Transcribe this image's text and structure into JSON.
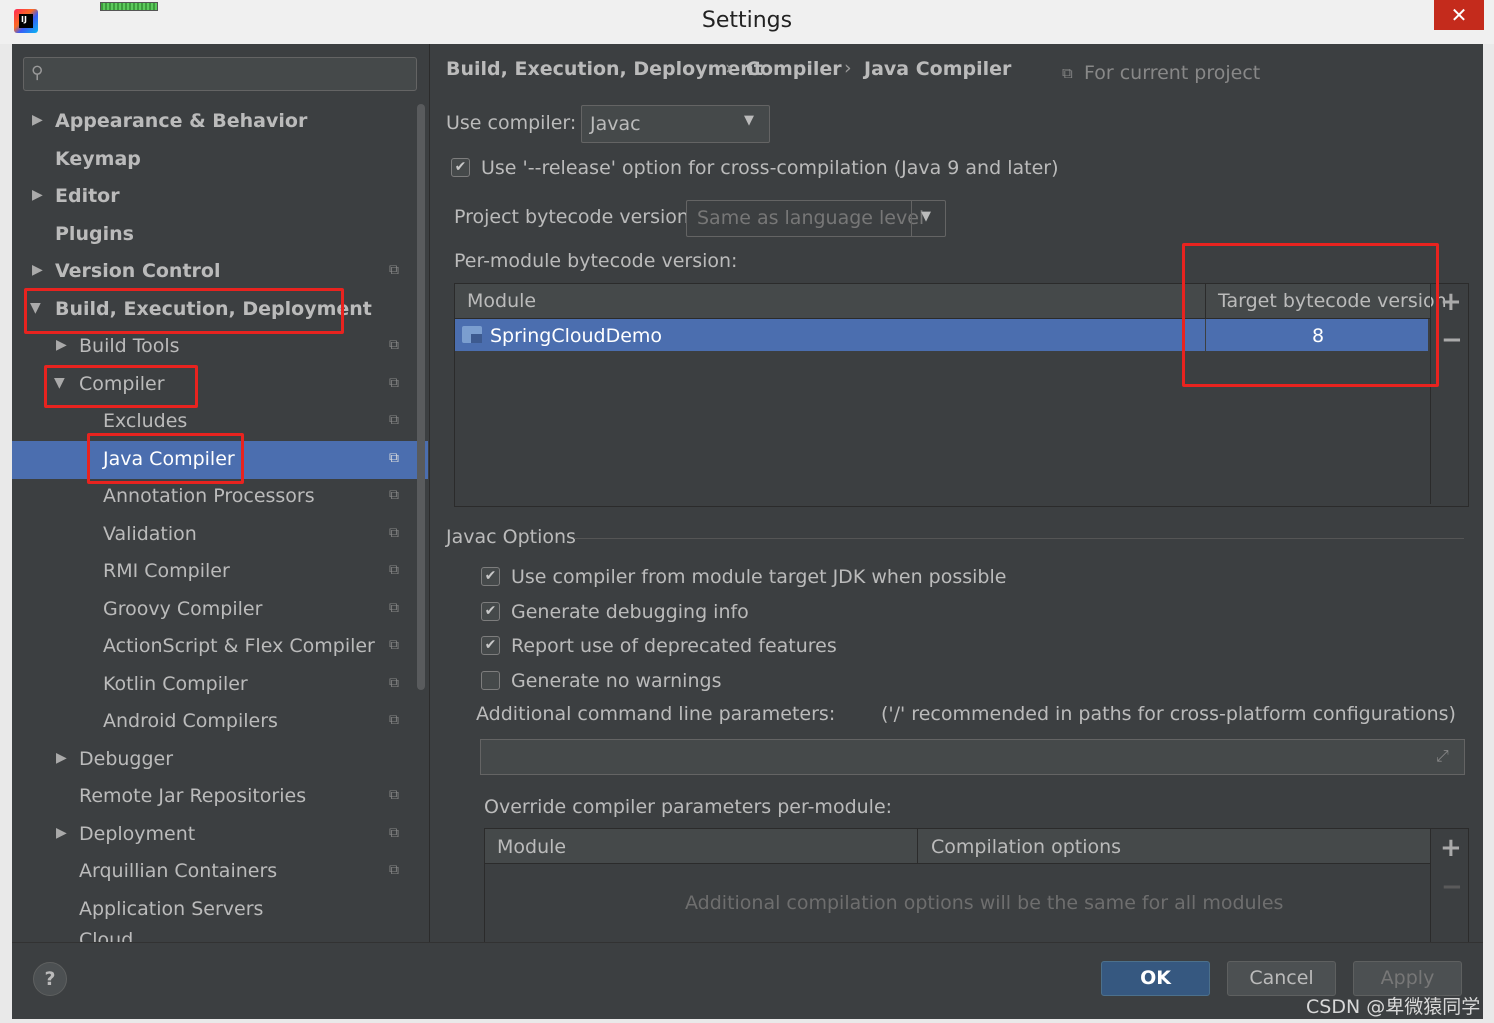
{
  "window": {
    "title": "Settings",
    "close_glyph": "✕"
  },
  "search": {
    "placeholder": ""
  },
  "sidebar": {
    "items": [
      {
        "label": "Appearance & Behavior"
      },
      {
        "label": "Keymap"
      },
      {
        "label": "Editor"
      },
      {
        "label": "Plugins"
      },
      {
        "label": "Version Control"
      },
      {
        "label": "Build, Execution, Deployment"
      },
      {
        "label": "Build Tools"
      },
      {
        "label": "Compiler"
      },
      {
        "label": "Excludes"
      },
      {
        "label": "Java Compiler"
      },
      {
        "label": "Annotation Processors"
      },
      {
        "label": "Validation"
      },
      {
        "label": "RMI Compiler"
      },
      {
        "label": "Groovy Compiler"
      },
      {
        "label": "ActionScript & Flex Compiler"
      },
      {
        "label": "Kotlin Compiler"
      },
      {
        "label": "Android Compilers"
      },
      {
        "label": "Debugger"
      },
      {
        "label": "Remote Jar Repositories"
      },
      {
        "label": "Deployment"
      },
      {
        "label": "Arquillian Containers"
      },
      {
        "label": "Application Servers"
      },
      {
        "label": "Cloud"
      }
    ]
  },
  "breadcrumb": {
    "items": [
      "Build, Execution, Deployment",
      "Compiler",
      "Java Compiler"
    ],
    "scope": "For current project"
  },
  "compiler": {
    "label": "Use compiler:",
    "value": "Javac"
  },
  "release_option": {
    "label": "Use '--release' option for cross-compilation (Java 9 and later)",
    "checked": true
  },
  "project_bytecode": {
    "label": "Project bytecode version:",
    "value": "Same as language level"
  },
  "per_module": {
    "label": "Per-module bytecode version:",
    "columns": [
      "Module",
      "Target bytecode version"
    ],
    "rows": [
      {
        "module": "SpringCloudDemo",
        "target": "8"
      }
    ],
    "add": "+",
    "remove": "−"
  },
  "javac": {
    "section": "Javac Options",
    "options": [
      {
        "label": "Use compiler from module target JDK when possible",
        "checked": true
      },
      {
        "label": "Generate debugging info",
        "checked": true
      },
      {
        "label": "Report use of deprecated features",
        "checked": true
      },
      {
        "label": "Generate no warnings",
        "checked": false
      }
    ],
    "additional_label": "Additional command line parameters:",
    "additional_hint": "('/' recommended in paths for cross-platform configurations)",
    "additional_value": ""
  },
  "override": {
    "label": "Override compiler parameters per-module:",
    "columns": [
      "Module",
      "Compilation options"
    ],
    "empty_text": "Additional compilation options will be the same for all modules",
    "add": "+",
    "remove": "−"
  },
  "footer": {
    "help": "?",
    "ok": "OK",
    "cancel": "Cancel",
    "apply": "Apply"
  },
  "watermark": "CSDN @卑微猿同学",
  "colors": {
    "selection": "#4b6eaf",
    "highlight": "#e8231f",
    "background": "#3c3f41"
  }
}
